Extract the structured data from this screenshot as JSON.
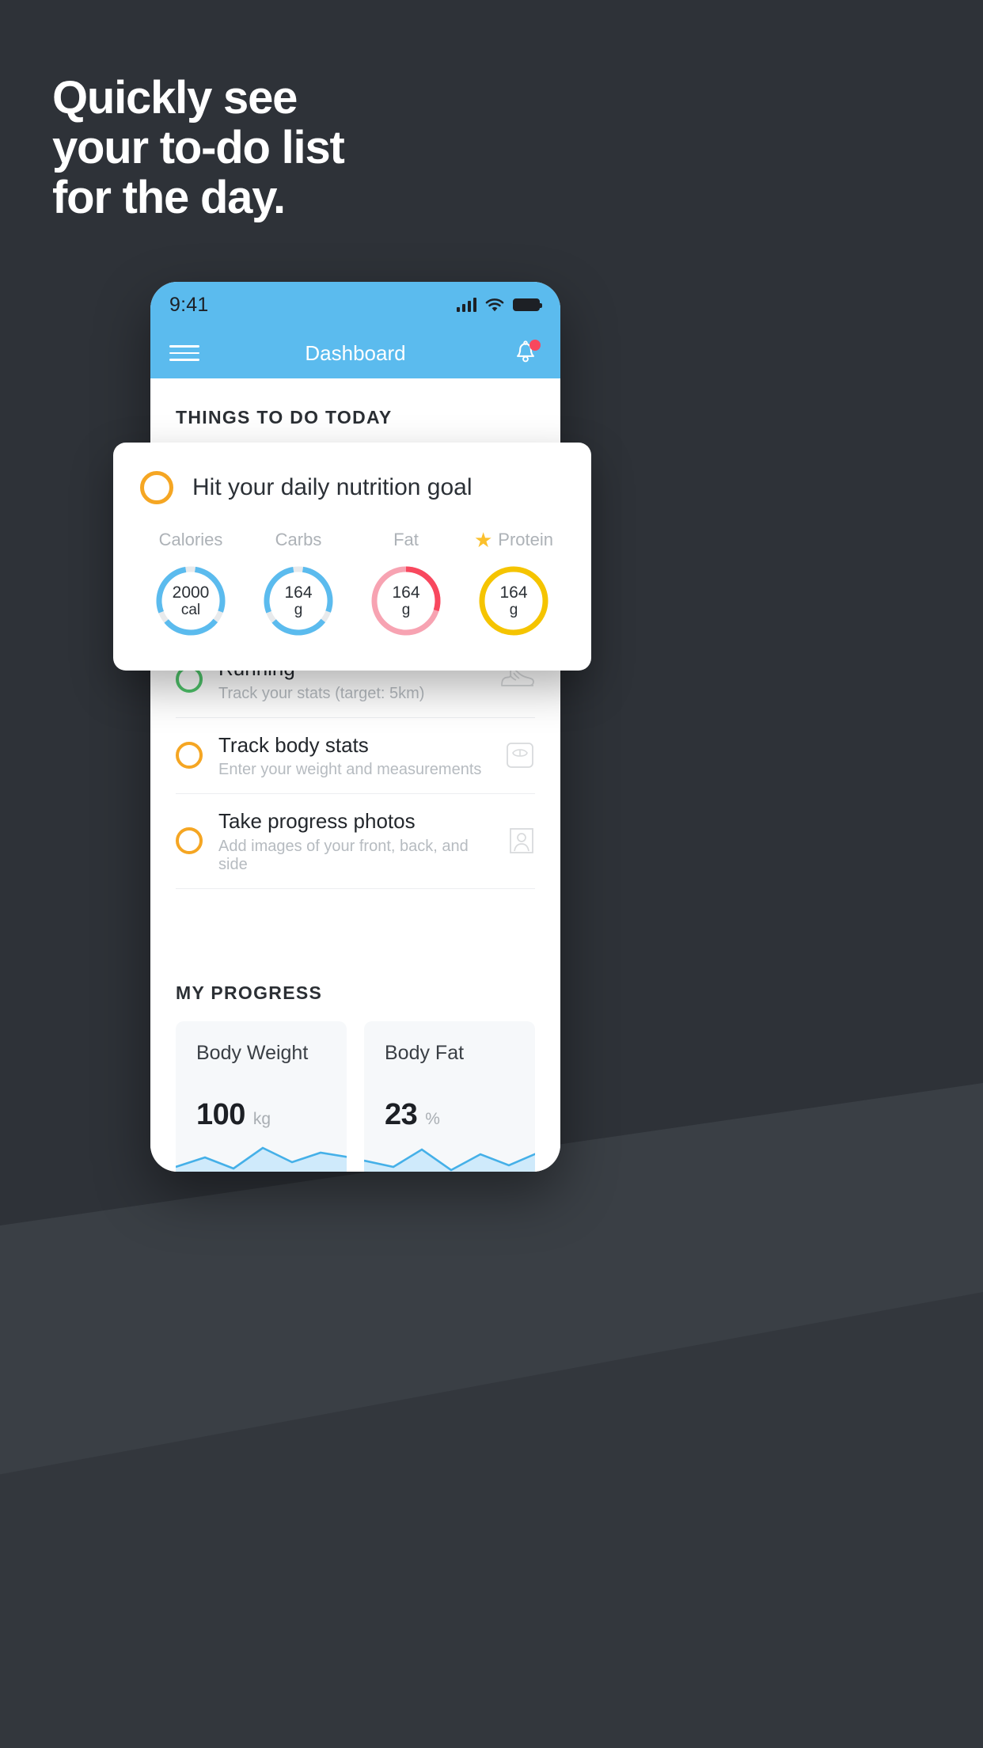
{
  "promo": {
    "headline": "Quickly see\nyour to-do list\nfor the day."
  },
  "colors": {
    "background": "#2e3238",
    "accent_blue": "#5bbbee",
    "amber": "#f5a623",
    "green": "#4fc46b",
    "red": "#f8485e",
    "gold": "#f5c400",
    "pink": "#f78a9c"
  },
  "phone": {
    "status_bar": {
      "time": "9:41",
      "signal_icon": "signal-bars-icon",
      "wifi_icon": "wifi-icon",
      "battery_icon": "battery-icon"
    },
    "nav": {
      "menu_icon": "hamburger-menu-icon",
      "title": "Dashboard",
      "notification_icon": "bell-icon",
      "has_notification_dot": true
    },
    "todo_section": {
      "heading": "THINGS TO DO TODAY",
      "tasks": [
        {
          "title": "Running",
          "subtitle": "Track your stats (target: 5km)",
          "ring_color": "green",
          "icon": "running-shoe-icon"
        },
        {
          "title": "Track body stats",
          "subtitle": "Enter your weight and measurements",
          "ring_color": "amber",
          "icon": "weight-scale-icon"
        },
        {
          "title": "Take progress photos",
          "subtitle": "Add images of your front, back, and side",
          "ring_color": "amber",
          "icon": "photo-person-icon"
        }
      ]
    },
    "progress_section": {
      "heading": "MY PROGRESS",
      "cards": [
        {
          "label": "Body Weight",
          "value": "100",
          "unit": "kg"
        },
        {
          "label": "Body Fat",
          "value": "23",
          "unit": "%"
        }
      ]
    }
  },
  "nutrition_card": {
    "checkbox_icon": "circle-checkbox-icon",
    "title": "Hit your daily nutrition goal",
    "macros": [
      {
        "label": "Calories",
        "value": "2000",
        "unit": "cal",
        "starred": false,
        "ring_style": "segmented-blue",
        "percent": 85
      },
      {
        "label": "Carbs",
        "value": "164",
        "unit": "g",
        "starred": false,
        "ring_style": "segmented-blue",
        "percent": 85
      },
      {
        "label": "Fat",
        "value": "164",
        "unit": "g",
        "starred": false,
        "ring_style": "pink-track-red-arc",
        "percent": 30
      },
      {
        "label": "Protein",
        "value": "164",
        "unit": "g",
        "starred": true,
        "star_icon": "star-icon",
        "ring_style": "solid-gold",
        "percent": 100
      }
    ]
  },
  "chart_data": [
    {
      "type": "area",
      "title": "Body Weight",
      "ylabel": "kg",
      "x": [
        0,
        1,
        2,
        3,
        4,
        5,
        6
      ],
      "values": [
        18,
        34,
        10,
        40,
        22,
        36,
        28
      ],
      "latest_value": 100,
      "unit": "kg",
      "grid": false,
      "legend": "none"
    },
    {
      "type": "area",
      "title": "Body Fat",
      "ylabel": "%",
      "x": [
        0,
        1,
        2,
        3,
        4,
        5,
        6
      ],
      "values": [
        24,
        16,
        38,
        12,
        32,
        20,
        34
      ],
      "latest_value": 23,
      "unit": "%",
      "grid": false,
      "legend": "none"
    }
  ]
}
